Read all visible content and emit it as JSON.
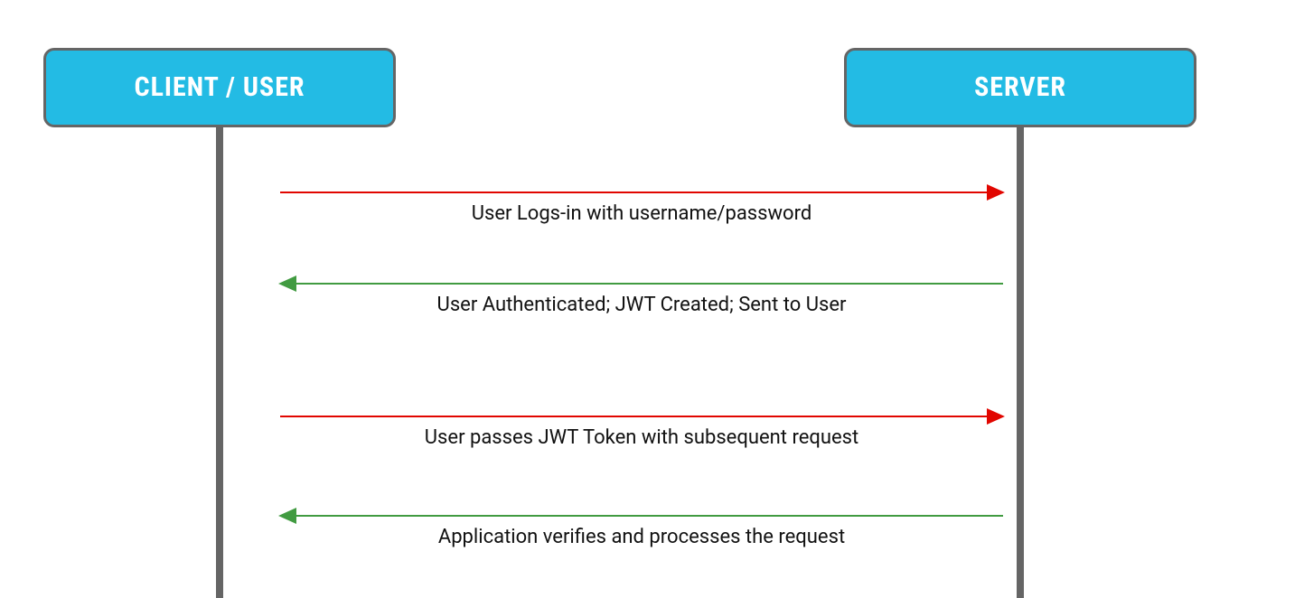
{
  "participants": {
    "client": "CLIENT / USER",
    "server": "SERVER"
  },
  "colors": {
    "participant_fill": "#23bbe4",
    "participant_border": "#656565",
    "participant_text": "#ffffff",
    "lifeline": "#656565",
    "arrow_request": "#e10600",
    "arrow_response": "#419b41",
    "label_text": "#111111"
  },
  "messages": [
    {
      "from": "client",
      "to": "server",
      "direction": "right",
      "color": "request",
      "label": "User Logs-in with username/password"
    },
    {
      "from": "server",
      "to": "client",
      "direction": "left",
      "color": "response",
      "label": "User Authenticated; JWT Created; Sent to User"
    },
    {
      "from": "client",
      "to": "server",
      "direction": "right",
      "color": "request",
      "label": "User passes JWT Token with subsequent request"
    },
    {
      "from": "server",
      "to": "client",
      "direction": "left",
      "color": "response",
      "label": "Application verifies and processes the request"
    }
  ]
}
